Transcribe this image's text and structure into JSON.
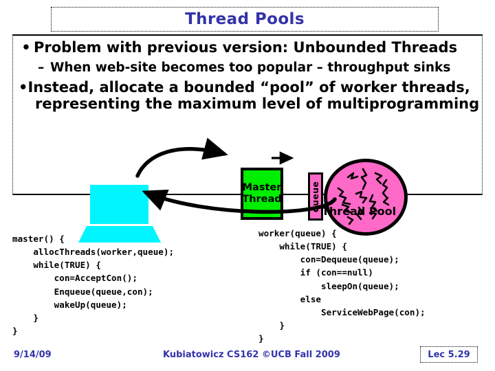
{
  "slide": {
    "title": "Thread Pools",
    "bullets": [
      {
        "level": 1,
        "marker": "•",
        "text": "Problem with previous version: Unbounded Threads"
      },
      {
        "level": 2,
        "marker": "–",
        "text": "When web-site becomes too popular – throughput sinks"
      },
      {
        "level": 1,
        "marker": "•",
        "line1": "Instead, allocate a bounded “pool” of worker threads,",
        "line2": "representing the maximum level of multiprogramming"
      }
    ]
  },
  "diagram": {
    "client_label": "laptop-client",
    "master_thread": {
      "line1": "Master",
      "line2": "Thread"
    },
    "queue": {
      "label": "queue"
    },
    "thread_pool": {
      "label": "Thread Pool"
    },
    "arrows": [
      {
        "name": "client-to-master",
        "direction": "right"
      },
      {
        "name": "master-to-queue",
        "direction": "right"
      },
      {
        "name": "pool-to-client",
        "direction": "left"
      }
    ],
    "colors": {
      "master_thread_fill": "#00ee00",
      "queue_fill": "#ff69c8",
      "thread_pool_fill": "#ff69c8",
      "laptop_fill": "#00f5ff",
      "outline": "#000000"
    }
  },
  "code": {
    "master": "master() {\n    allocThreads(worker,queue);\n    while(TRUE) {\n        con=AcceptCon();\n        Enqueue(queue,con);\n        wakeUp(queue);\n    }\n}",
    "worker": "worker(queue) {\n    while(TRUE) {\n        con=Dequeue(queue);\n        if (con==null)\n            sleepOn(queue);\n        else\n            ServiceWebPage(con);\n    }\n}"
  },
  "footer": {
    "date": "9/14/09",
    "center": "Kubiatowicz CS162 ©UCB Fall 2009",
    "lecture": "Lec 5.29",
    "color": "#3333aa"
  }
}
